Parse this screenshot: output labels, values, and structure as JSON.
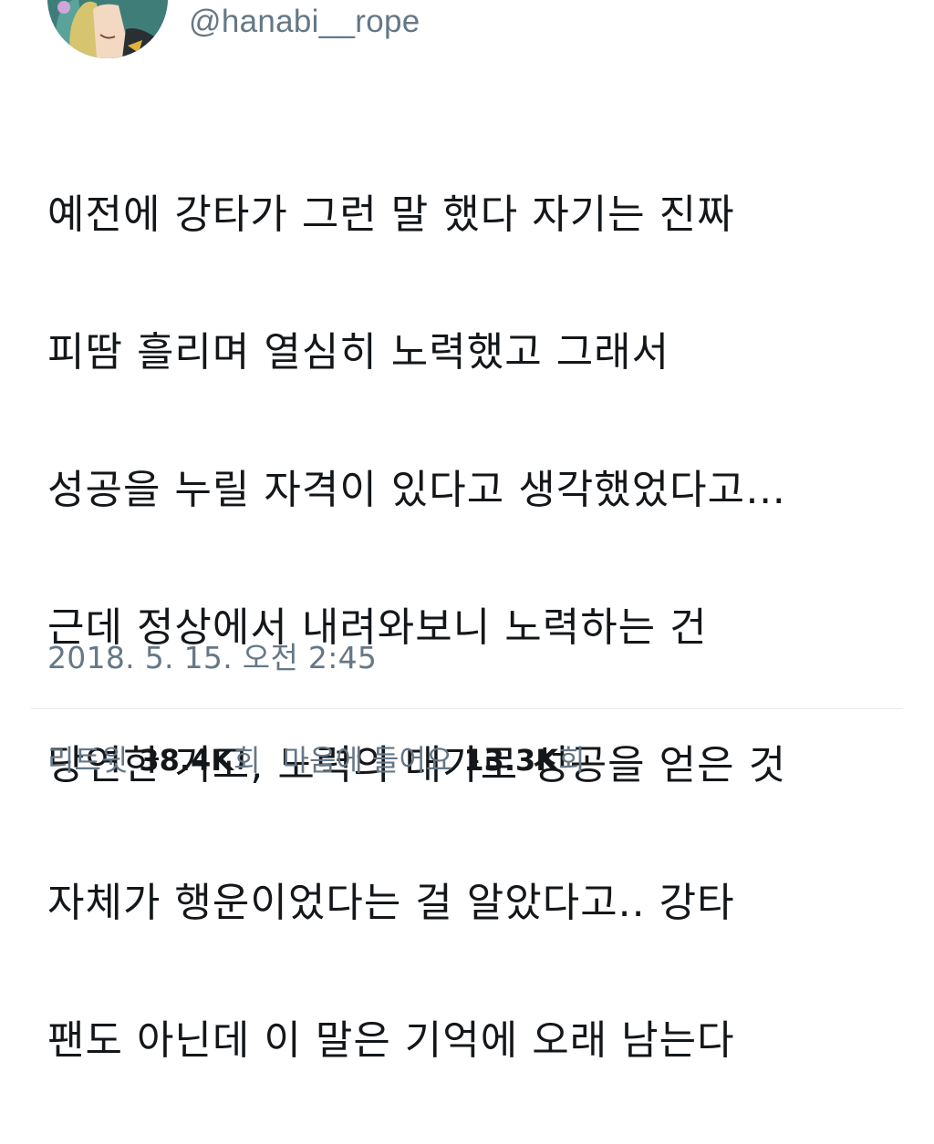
{
  "user": {
    "handle": "@hanabi__rope",
    "avatar_icon": "anime-avatar-icon"
  },
  "tweet": {
    "lines": [
      "예전에 강타가 그런 말 했다 자기는 진짜",
      "피땀 흘리며 열심히 노력했고 그래서",
      "성공을 누릴 자격이 있다고 생각했었다고…",
      "근데 정상에서 내려와보니 노력하는 건",
      "당연한 거고, 노력의 대가로 성공을 얻은 것",
      "자체가 행운이었다는 걸 알았다고.. 강타",
      "팬도 아닌데 이 말은 기억에 오래 남는다"
    ],
    "timestamp": "2018. 5. 15. 오전 2:45"
  },
  "stats": {
    "retweets_label": "리트윗",
    "retweets_count": "38.4K",
    "retweets_suffix": "회",
    "likes_label": "마음에 들어요",
    "likes_count": "13.3K",
    "likes_suffix": "회"
  },
  "colors": {
    "text": "#14171a",
    "secondary": "#657786",
    "divider": "#e1e8ed",
    "avatar_bg": "#3f7d79"
  }
}
